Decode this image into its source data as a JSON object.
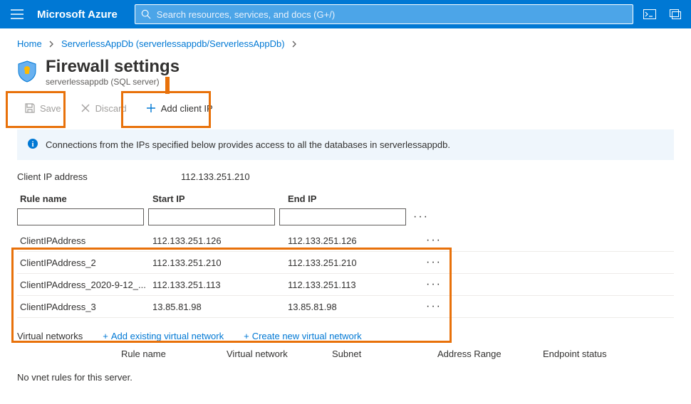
{
  "topbar": {
    "brand": "Microsoft Azure",
    "search_placeholder": "Search resources, services, and docs (G+/)"
  },
  "breadcrumb": {
    "home": "Home",
    "item": "ServerlessAppDb (serverlessappdb/ServerlessAppDb)"
  },
  "header": {
    "title": "Firewall settings",
    "subtitle": "serverlessappdb (SQL server)"
  },
  "toolbar": {
    "save": "Save",
    "discard": "Discard",
    "add_client_ip": "Add client IP"
  },
  "info_banner": "Connections from the IPs specified below provides access to all the databases in serverlessappdb.",
  "client_ip": {
    "label": "Client IP address",
    "value": "112.133.251.210"
  },
  "rules": {
    "headers": {
      "rule_name": "Rule name",
      "start_ip": "Start IP",
      "end_ip": "End IP"
    },
    "rows": [
      {
        "name": "ClientIPAddress",
        "start": "112.133.251.126",
        "end": "112.133.251.126"
      },
      {
        "name": "ClientIPAddress_2",
        "start": "112.133.251.210",
        "end": "112.133.251.210"
      },
      {
        "name": "ClientIPAddress_2020-9-12_...",
        "start": "112.133.251.113",
        "end": "112.133.251.113"
      },
      {
        "name": "ClientIPAddress_3",
        "start": "13.85.81.98",
        "end": "13.85.81.98"
      }
    ]
  },
  "vnet": {
    "label": "Virtual networks",
    "add_existing": "Add existing virtual network",
    "create_new": "Create new virtual network",
    "headers": {
      "rule_name": "Rule name",
      "virtual_network": "Virtual network",
      "subnet": "Subnet",
      "address_range": "Address Range",
      "endpoint_status": "Endpoint status"
    },
    "empty": "No vnet rules for this server."
  }
}
